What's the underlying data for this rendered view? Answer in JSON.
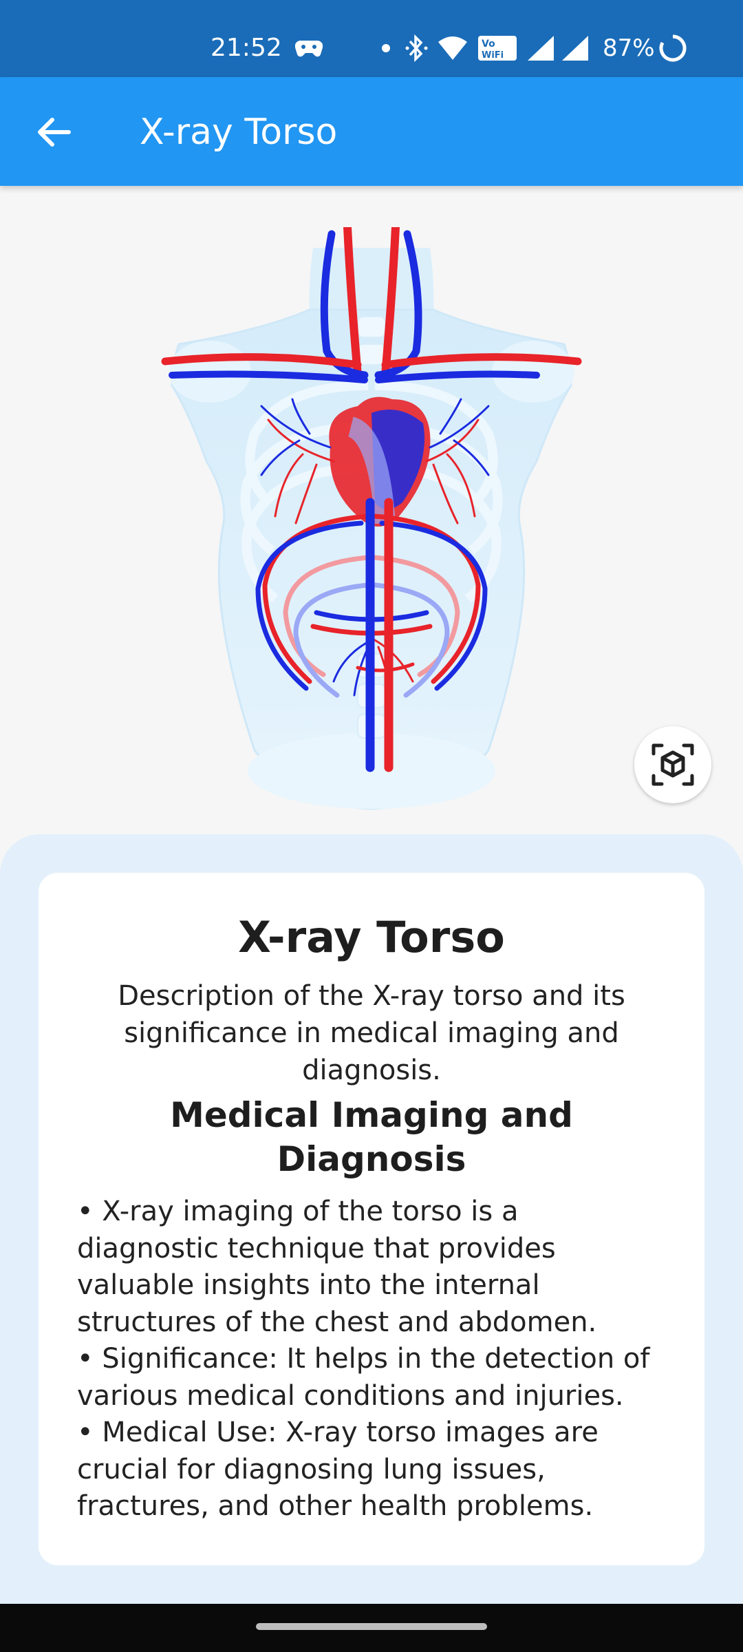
{
  "status_bar": {
    "time": "21:52",
    "battery_percent": "87%",
    "icons": [
      "game-controller-icon",
      "notification-dot-icon",
      "bluetooth-icon",
      "wifi-icon",
      "vowifi-icon",
      "signal-icon",
      "signal-icon",
      "battery-saver-icon"
    ]
  },
  "app_bar": {
    "title": "X-ray Torso",
    "back_icon": "arrow-left-icon"
  },
  "model_viewer": {
    "image_subject": "x-ray-torso-vascular-3d-model",
    "ar_icon": "ar-cube-icon"
  },
  "info_card": {
    "title": "X-ray Torso",
    "description": "Description of the X-ray torso and its significance in medical imaging and diagnosis.",
    "subtitle": "Medical Imaging and Diagnosis",
    "bullets": [
      "• X-ray imaging of the torso is a diagnostic technique that provides valuable insights into the internal structures of the chest and abdomen.",
      "• Significance: It helps in the detection of various medical conditions and injuries.",
      "• Medical Use: X-ray torso images are crucial for diagnosing lung issues, fractures, and other health problems."
    ]
  },
  "colors": {
    "status_bar": "#1a6cb8",
    "app_bar": "#2196f3",
    "panel_bg": "#e3f0fb",
    "artery": "#e8232a",
    "vein": "#1a2be0"
  }
}
